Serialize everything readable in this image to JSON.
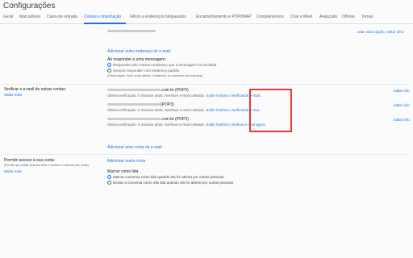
{
  "page_title": "Configurações",
  "tabs": [
    "Geral",
    "Marcadores",
    "Caixa de entrada",
    "Contas e importação",
    "Filtros e endereços bloqueados",
    "Encaminhamento e POP/IMAP",
    "Complementos",
    "Chat e Meet",
    "Avançado",
    "Off-line",
    "Temas"
  ],
  "top_right_link": "usar outra opção, editar infor",
  "send_as": {
    "add_link": "Adicionar outro endereço de e-mail",
    "reply_heading": "Ao responder a uma mensagem:",
    "reply_option_1": "Responder pelo mesmo endereço que a mensagem foi recebida",
    "reply_option_2": "Sempre responder com endereço padrão",
    "reply_note": "(Observação: Você pode alterar o endereço no momento da resposta)"
  },
  "check_mail": {
    "label": "Verificar o e-mail de outras contas:",
    "learn_more": "Saiba mais",
    "accounts": [
      {
        "suffix": ".com.br (POP3)",
        "status": "Última verificação: 0 minutos atrás. Nenhum e-mail coletado.",
        "history": "Exibir histórico",
        "checking": "Verificando e-mail..."
      },
      {
        "suffix": "(POP3)",
        "status": "Última verificação: 0 minutos atrás. Nenhum e-mail coletado.",
        "history": "Exibir histórico",
        "checking": "Verificando e-mai..."
      },
      {
        "suffix": ".com.br (POP3)",
        "status": "Última verificação: 0 minutos atrás. Nenhum e-mail coletado.",
        "history": "Exibir histórico",
        "checking": "Verificar e-mail agora"
      }
    ],
    "edit_label": "editar info",
    "add_account": "Adicionar uma conta de e-mail"
  },
  "add_other_account": "Adicionar outra conta",
  "grant_access": {
    "label": "Permitir acesso à sua conta:",
    "sub": "(Permitir que outras pessoas leiam e enviem e-mails em seu nome)",
    "learn_more": "Saiba mais"
  },
  "mark_read": {
    "heading": "Marcar como lida",
    "option_1": "Marcar conversa como lida quando ela for aberta por outras pessoas",
    "option_2": "Deixar a conversa como não lida quando ela for aberta por outras pessoas"
  }
}
